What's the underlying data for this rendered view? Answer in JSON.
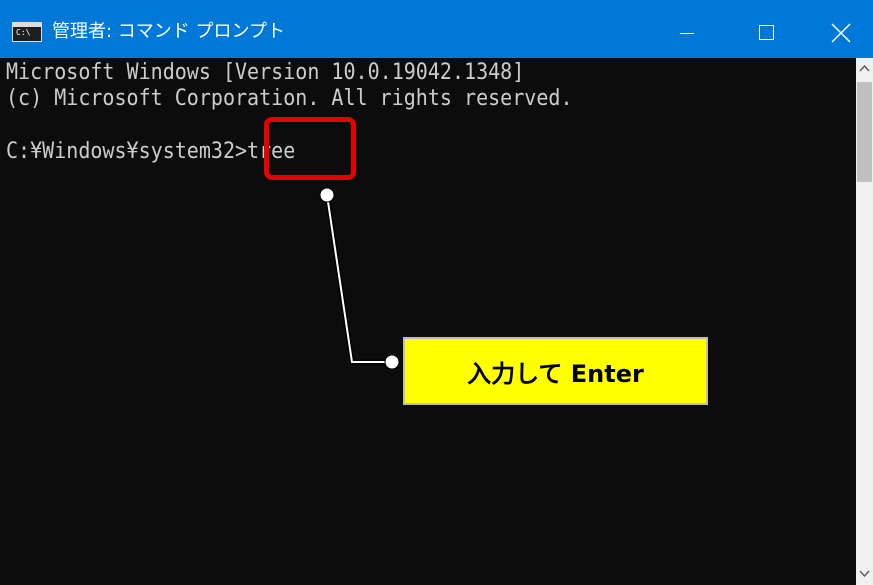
{
  "window": {
    "title": "管理者: コマンド プロンプト",
    "icon_name": "console-icon",
    "icon_text": "C:\\",
    "controls": {
      "minimize": "minimize-icon",
      "maximize": "maximize-icon",
      "close": "close-icon"
    },
    "titlebar_color": "#0078d7"
  },
  "console": {
    "lines": [
      "Microsoft Windows [Version 10.0.19042.1348]",
      "(c) Microsoft Corporation. All rights reserved.",
      "",
      "C:¥Windows¥system32>tree"
    ],
    "background": "#0c0c0c",
    "text_color": "#cccccc"
  },
  "annotation": {
    "highlight_color": "#e60000",
    "callout_text": "入力して Enter",
    "callout_background": "#ffff00"
  }
}
